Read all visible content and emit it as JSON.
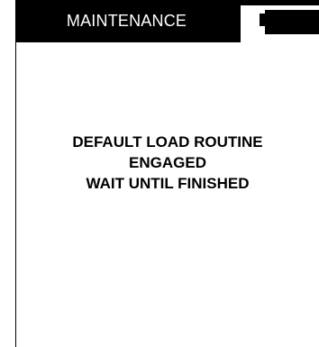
{
  "header": {
    "title": "MAINTENANCE"
  },
  "message": {
    "lines": [
      "DEFAULT LOAD ROUTINE",
      "ENGAGED",
      "WAIT UNTIL FINISHED"
    ]
  },
  "colors": {
    "background": "#ffffff",
    "header_background": "#000000",
    "header_text": "#ffffff",
    "message_text": "#000000"
  }
}
